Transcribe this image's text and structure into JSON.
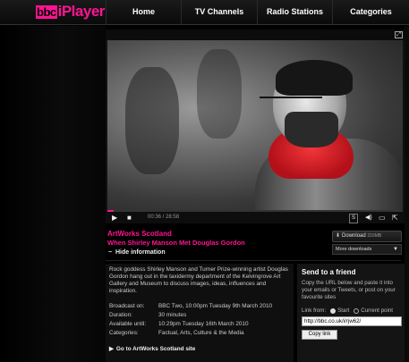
{
  "header": {
    "logo": "iPlayer",
    "nav": [
      "Home",
      "TV Channels",
      "Radio Stations",
      "Categories"
    ]
  },
  "player": {
    "time": "00:36 / 28:58",
    "progress_fraction": 0.02,
    "subtitles_label": "S"
  },
  "programme": {
    "series": "ArtWorks Scotland",
    "episode": "When Shirley Manson Met Douglas Gordon",
    "hide_info": "Hide information"
  },
  "download": {
    "label": "Download",
    "size": "316MB",
    "more_label": "More downloads"
  },
  "description": {
    "text": "Rock goddess Shirley Manson and Turner Prize-winning artist Douglas Gordon hang out in the taxidermy department of the Kelvingrove Art Gallery and Museum to discuss images, ideas, influences and inspiration.",
    "meta": [
      {
        "key": "Broadcast on:",
        "value": "BBC Two, 10:00pm Tuesday 9th March 2010"
      },
      {
        "key": "Duration:",
        "value": "30 minutes"
      },
      {
        "key": "Available until:",
        "value": "10:29pm Tuesday 16th March 2010"
      },
      {
        "key": "Categories:",
        "value": "Factual, Arts, Culture & the Media"
      }
    ],
    "goto_link": "Go to ArtWorks Scotland site"
  },
  "send": {
    "title": "Send to a friend",
    "desc": "Copy the URL below and paste it into your emails or Tweets, or post on your favourite sites",
    "link_from": "Link from:",
    "option_start": "Start",
    "option_current": "Current point",
    "url": "http://bbc.co.uk/i/rjw62/",
    "copy_label": "Copy link"
  },
  "colors": {
    "accent": "#ff1493",
    "background": "#000000"
  }
}
